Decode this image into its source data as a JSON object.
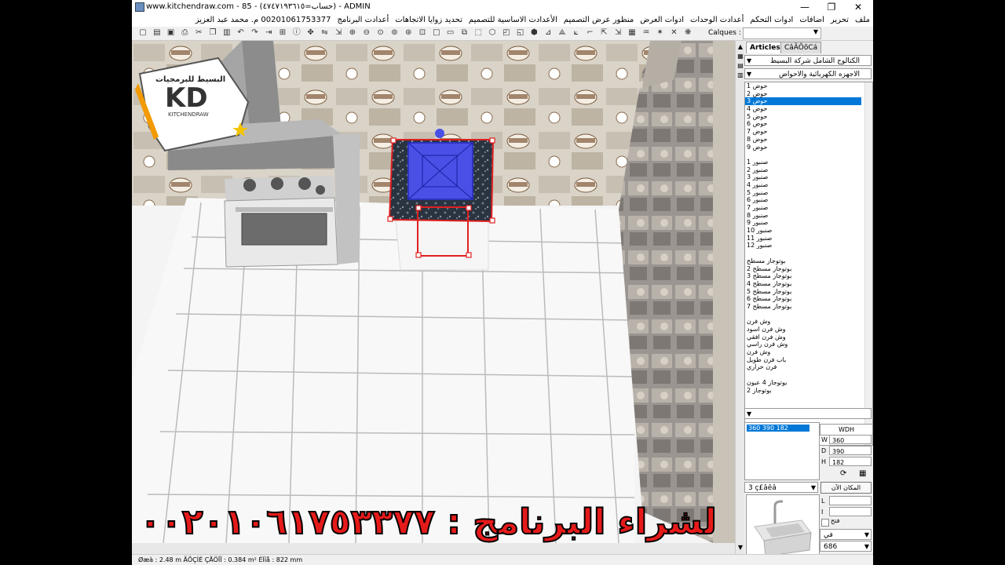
{
  "window": {
    "title": "www.kitchendraw.com - 85 - (حساب=٤٧٤٧١٩٣٦١٥) - ADMIN",
    "minimize": "—",
    "maximize": "❐",
    "close": "✕"
  },
  "menu": {
    "items": [
      "ملف",
      "تحرير",
      "اضافات",
      "ادوات التحكم",
      "أعدادت الوحدات",
      "ادوات العرض",
      "منظور عرض التصميم",
      "الأعدادت الاساسية للتصميم",
      "تحديد زوايا الاتجاهات",
      "أعدادت البرنامج",
      "00201061753377 م. محمد عبد العزيز"
    ]
  },
  "toolbar": {
    "calques_label": "Calques :"
  },
  "logo": {
    "brand": "KD",
    "name": "KITCHENDRAW",
    "tagline": "البسيط للبرمجيات"
  },
  "panel": {
    "tabs": [
      "Articles",
      "CâÃÕõCá"
    ],
    "catalog": "الكتالوج الشامل شركة البسيط",
    "category": "الاجهزه الكهربائية والاحواض",
    "items": [
      "حوض 1",
      "حوض 2",
      "حوض 3",
      "حوض 4",
      "حوض 5",
      "حوض 6",
      "حوض 7",
      "حوض 8",
      "حوض 9",
      "",
      "صنبور 1",
      "صنبور 2",
      "صنبور 3",
      "صنبور 4",
      "صنبور 5",
      "صنبور 6",
      "صنبور 7",
      "صنبور 8",
      "صنبور 9",
      "صنبور 10",
      "صنبور 11",
      "صنبور 12",
      "",
      "بوتوجاز مسطح",
      "بوتوجاز مسطح 2",
      "بوتوجاز مسطح 3",
      "بوتوجاز مسطح 4",
      "بوتوجاز مسطح 5",
      "بوتوجاز مسطح 6",
      "بوتوجاز مسطح 7",
      "",
      "وش فرن",
      "وش فرن اسود",
      "وش فرن افقي",
      "وش فرن راسي",
      "وش فرن",
      "باب فرن طويل",
      "فرن حراري",
      "",
      "بوتوجاز 4 عيون",
      "بوتوجاز 2"
    ],
    "selected_index": 2,
    "dims_selected": "360  390  182",
    "wdh_label": "WDH",
    "w_label": "W",
    "w": "360",
    "d_label": "D",
    "d": "390",
    "h_label": "H",
    "h": "182",
    "variant": "3 ç£âêâ",
    "place_button": "المكان الآن",
    "l_label": "L",
    "i_label": "I",
    "checkbox_label": "فتح",
    "side_select": "في",
    "code_select": "686"
  },
  "status": {
    "text": "Øæà : 2.48 m   ÃÕÇÍÉ ÇÃÖÏÏ : 0.384 m²   ÉÏíå : 822 mm"
  },
  "banner": {
    "text": "لشراء البرنامج : ٠٠٢٠١٠٦١٧٥٣٣٧٧"
  },
  "colors": {
    "selection": "#0078d7",
    "banner": "#e51a1a",
    "marker": "#e02020"
  }
}
